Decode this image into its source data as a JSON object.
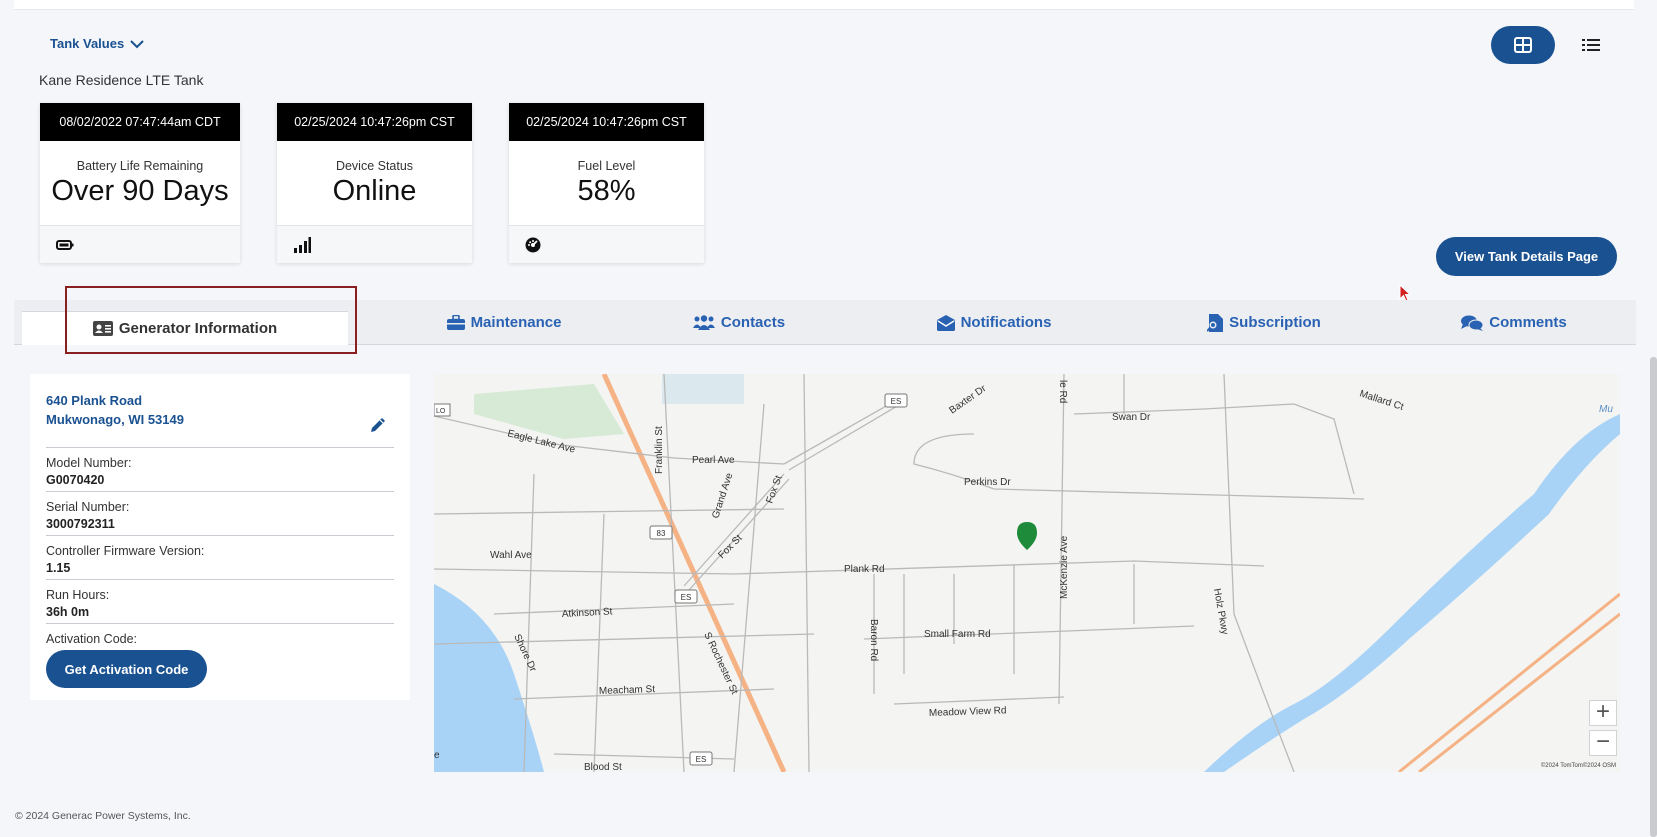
{
  "header": {
    "tank_values_label": "Tank Values",
    "tank_name": "Kane Residence LTE Tank"
  },
  "cards": [
    {
      "timestamp": "08/02/2022 07:47:44am CDT",
      "label": "Battery Life Remaining",
      "value": "Over 90 Days",
      "icon": "battery-icon"
    },
    {
      "timestamp": "02/25/2024 10:47:26pm CST",
      "label": "Device Status",
      "value": "Online",
      "icon": "signal-icon"
    },
    {
      "timestamp": "02/25/2024 10:47:26pm CST",
      "label": "Fuel Level",
      "value": "58%",
      "icon": "gauge-icon"
    }
  ],
  "view_details_label": "View Tank Details Page",
  "tabs": [
    {
      "label": "Generator Information",
      "icon": "id-card-icon"
    },
    {
      "label": "Maintenance",
      "icon": "toolbox-icon"
    },
    {
      "label": "Contacts",
      "icon": "users-icon"
    },
    {
      "label": "Notifications",
      "icon": "mail-icon"
    },
    {
      "label": "Subscription",
      "icon": "search-doc-icon"
    },
    {
      "label": "Comments",
      "icon": "comments-icon"
    }
  ],
  "generator": {
    "address_line1": "640 Plank Road",
    "address_line2": "Mukwonago, WI 53149",
    "fields": [
      {
        "label": "Model Number:",
        "value": "G0070420"
      },
      {
        "label": "Serial Number:",
        "value": "3000792311"
      },
      {
        "label": "Controller Firmware Version:",
        "value": "1.15"
      },
      {
        "label": "Run Hours:",
        "value": "36h 0m"
      }
    ],
    "activation_label": "Activation Code:",
    "activation_button": "Get Activation Code"
  },
  "map": {
    "streets": [
      "Eagle Lake Ave",
      "Pearl Ave",
      "Franklin St",
      "Grand Ave",
      "Fox St",
      "Fox St",
      "Baxter Dr",
      "Swan Dr",
      "Mallard Ct",
      "Perkins Dr",
      "Plank Rd",
      "McKenzie Ave",
      "Holz Pkwy",
      "Wahl Ave",
      "Atkinson St",
      "Shore Dr",
      "S Rochester St",
      "Baron Rd",
      "Small Farm Rd",
      "Meacham St",
      "Meadow View Rd",
      "Blood St"
    ],
    "shields": [
      "ES",
      "83",
      "ES",
      "ES"
    ],
    "edge_labels": [
      "LO",
      "Mu",
      "le Rd",
      "e"
    ],
    "zoom_in": "+",
    "zoom_out": "−",
    "attribution": "©2024 TomTom©2024 OSM",
    "marker_color": "#1e8b3a"
  },
  "footer": "© 2024 Generac Power Systems, Inc.",
  "colors": {
    "primary": "#1a5191",
    "tab_text": "#2a62b3",
    "highlight": "#8a1f1f"
  }
}
